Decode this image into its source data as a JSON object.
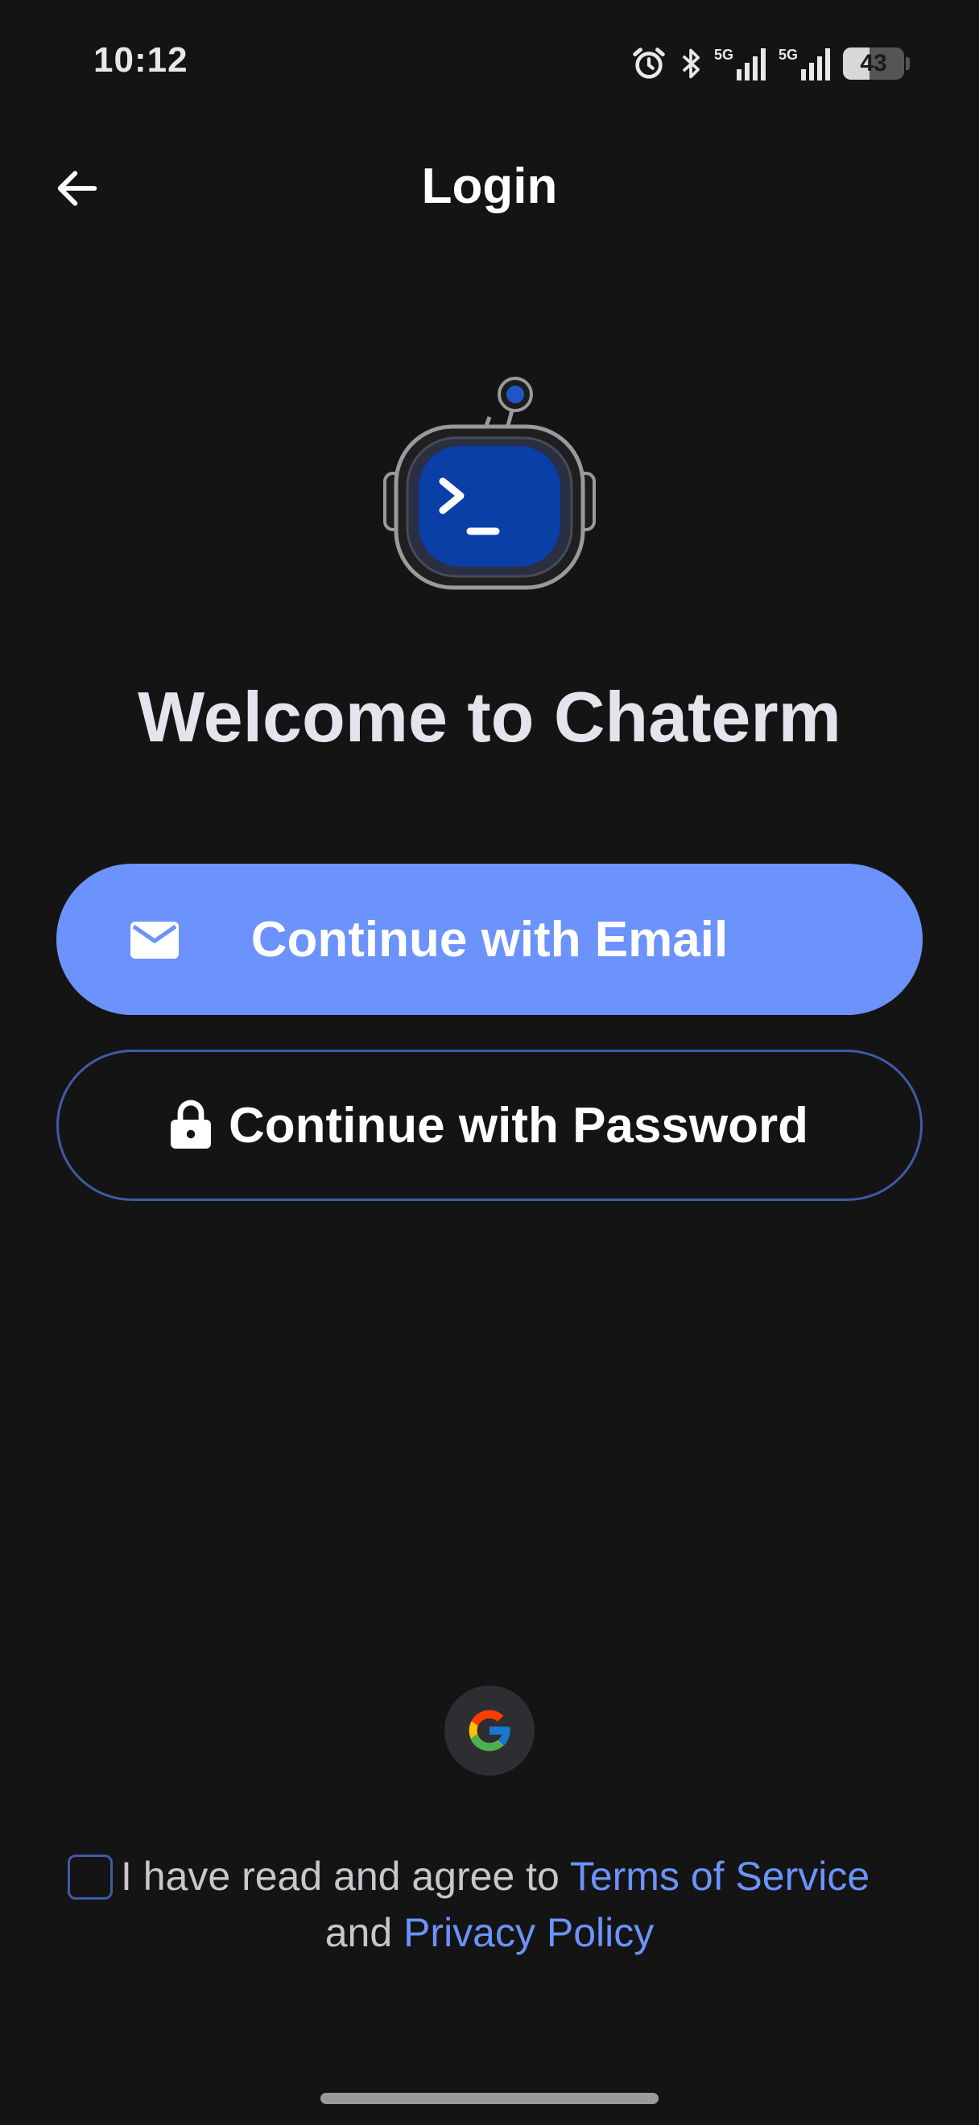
{
  "status_bar": {
    "time": "10:12",
    "network_1": "5G",
    "network_2": "5G",
    "battery": "43"
  },
  "app_bar": {
    "title": "Login"
  },
  "welcome": {
    "title": "Welcome to Chaterm"
  },
  "buttons": {
    "email_label": "Continue with Email",
    "password_label": "Continue with Password"
  },
  "agreement": {
    "prefix": "I have read and agree to ",
    "terms_link": "Terms of Service",
    "conjunction": "and ",
    "privacy_link": "Privacy Policy",
    "checked": false
  },
  "colors": {
    "background": "#141414",
    "accent": "#6b93fb",
    "outline": "#3e5ba8",
    "logo_screen": "#0a3fa8"
  }
}
